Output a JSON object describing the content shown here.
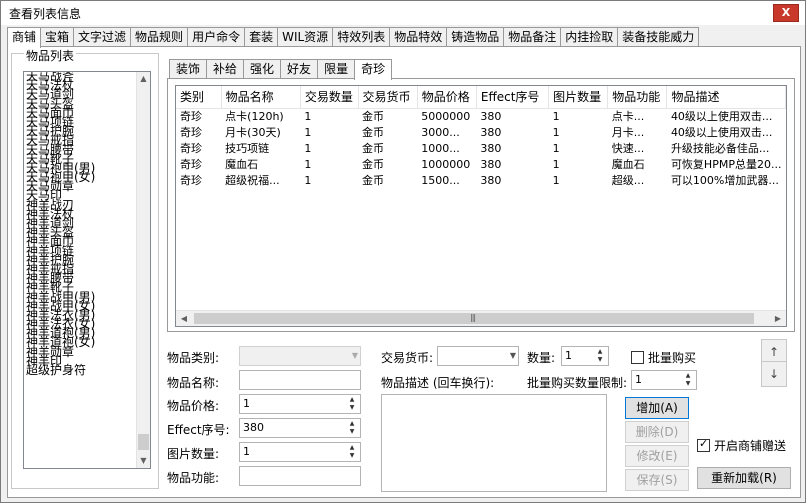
{
  "window": {
    "title": "查看列表信息",
    "close_label": "X"
  },
  "top_tabs": [
    "商铺",
    "宝箱",
    "文字过滤",
    "物品规则",
    "用户命令",
    "套装",
    "WIL资源",
    "特效列表",
    "物品特效",
    "铸造物品",
    "物品备注",
    "内挂捡取",
    "装备技能威力"
  ],
  "active_top_tab": 0,
  "item_list": {
    "legend": "物品列表",
    "items": [
      "天马战斧",
      "天马法杖",
      "天马道剑",
      "天马头盔",
      "天马面巾",
      "天马项链",
      "天马护腕",
      "天马戒指",
      "天马腰带",
      "天马靴子",
      "天马袍甲(男)",
      "天马袍甲(女)",
      "天马勋章",
      "天马印",
      "神羊战刃",
      "神羊法杖",
      "神羊道剑",
      "神羊头盔",
      "神羊面巾",
      "神羊项链",
      "神羊护腕",
      "神羊戒指",
      "神羊腰带",
      "神羊靴子",
      "神羊战甲(男)",
      "神羊战甲(女)",
      "神羊法衣(男)",
      "神羊法衣(女)",
      "神羊道袍(男)",
      "神羊道袍(女)",
      "神羊勋章",
      "神羊印",
      "超级护身符"
    ]
  },
  "sub_tabs": [
    "装饰",
    "补给",
    "强化",
    "好友",
    "限量",
    "奇珍"
  ],
  "active_sub_tab": 5,
  "table": {
    "columns": [
      "类别",
      "物品名称",
      "交易数量",
      "交易货币",
      "物品价格",
      "Effect序号",
      "图片数量",
      "物品功能",
      "物品描述"
    ],
    "rows": [
      [
        "奇珍",
        "点卡(120h)",
        "1",
        "金币",
        "5000000",
        "380",
        "1",
        "点卡...",
        "40级以上使用双击..."
      ],
      [
        "奇珍",
        "月卡(30天)",
        "1",
        "金币",
        "3000...",
        "380",
        "1",
        "月卡...",
        "40级以上使用双击..."
      ],
      [
        "奇珍",
        "技巧项链",
        "1",
        "金币",
        "1000...",
        "380",
        "1",
        "快速...",
        "升级技能必备佳品..."
      ],
      [
        "奇珍",
        "魔血石",
        "1",
        "金币",
        "1000000",
        "380",
        "1",
        "魔血石",
        "可恢复HPMP总量20..."
      ],
      [
        "奇珍",
        "超级祝福...",
        "1",
        "金币",
        "1500...",
        "380",
        "1",
        "超级...",
        "可以100%增加武器..."
      ]
    ],
    "scroll_grip": "|||"
  },
  "form": {
    "category_label": "物品类别:",
    "category_value": "",
    "name_label": "物品名称:",
    "name_value": "",
    "price_label": "物品价格:",
    "price_value": "1",
    "effect_label": "Effect序号:",
    "effect_value": "380",
    "image_count_label": "图片数量:",
    "image_count_value": "1",
    "function_label": "物品功能:",
    "function_value": "",
    "currency_label": "交易货币:",
    "currency_value": "",
    "quantity_label": "数量:",
    "quantity_value": "1",
    "bulk_buy_label": "批量购买",
    "bulk_buy_checked": false,
    "description_label": "物品描述 (回车换行):",
    "description_value": "",
    "bulk_limit_label": "批量购买数量限制:",
    "bulk_limit_value": "1",
    "enable_gift_label": "开启商铺赠送",
    "enable_gift_checked": true
  },
  "buttons": {
    "add": "增加(A)",
    "delete": "删除(D)",
    "modify": "修改(E)",
    "save": "保存(S)",
    "reload": "重新加载(R)",
    "up": "↑",
    "down": "↓"
  }
}
